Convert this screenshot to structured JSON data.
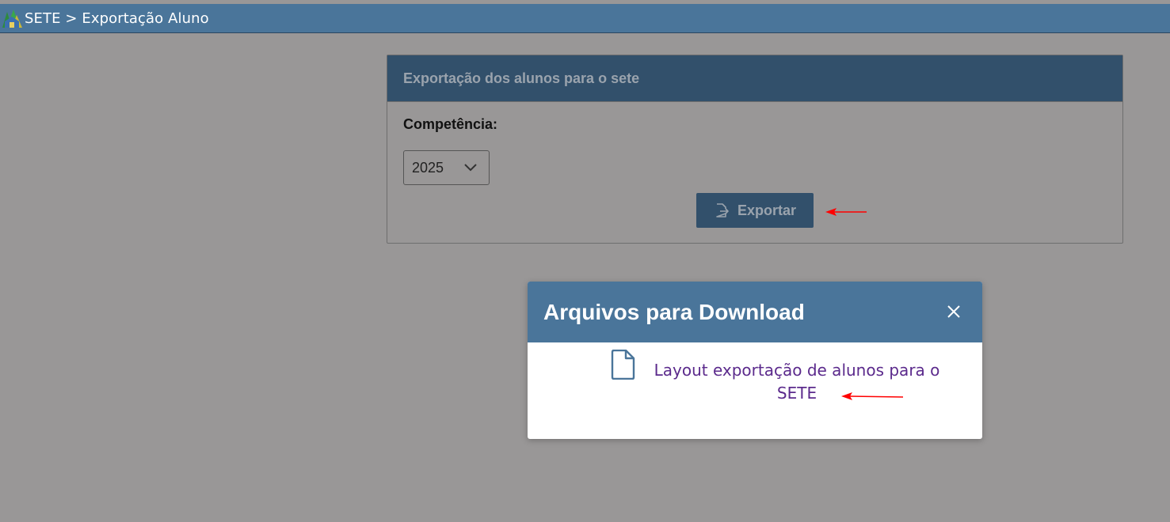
{
  "header": {
    "breadcrumb": "SETE > Exportação Aluno",
    "logo_icon": "sete-logo-icon"
  },
  "panel": {
    "title": "Exportação dos alunos para o sete",
    "competencia_label": "Competência:",
    "competencia_select": {
      "selected": "2025"
    },
    "export_button": {
      "label": "Exportar",
      "icon": "export-file-icon"
    }
  },
  "modal": {
    "title": "Arquivos para Download",
    "close_icon": "close-icon",
    "files": [
      {
        "label": "Layout exportação de alunos para o SETE",
        "icon": "file-icon"
      }
    ]
  },
  "colors": {
    "topbar": "#4a759a",
    "panel_header": "#32506b",
    "overlay_bg": "#999797",
    "link": "#5b2a8c",
    "annotation_arrow": "#ff0000"
  }
}
